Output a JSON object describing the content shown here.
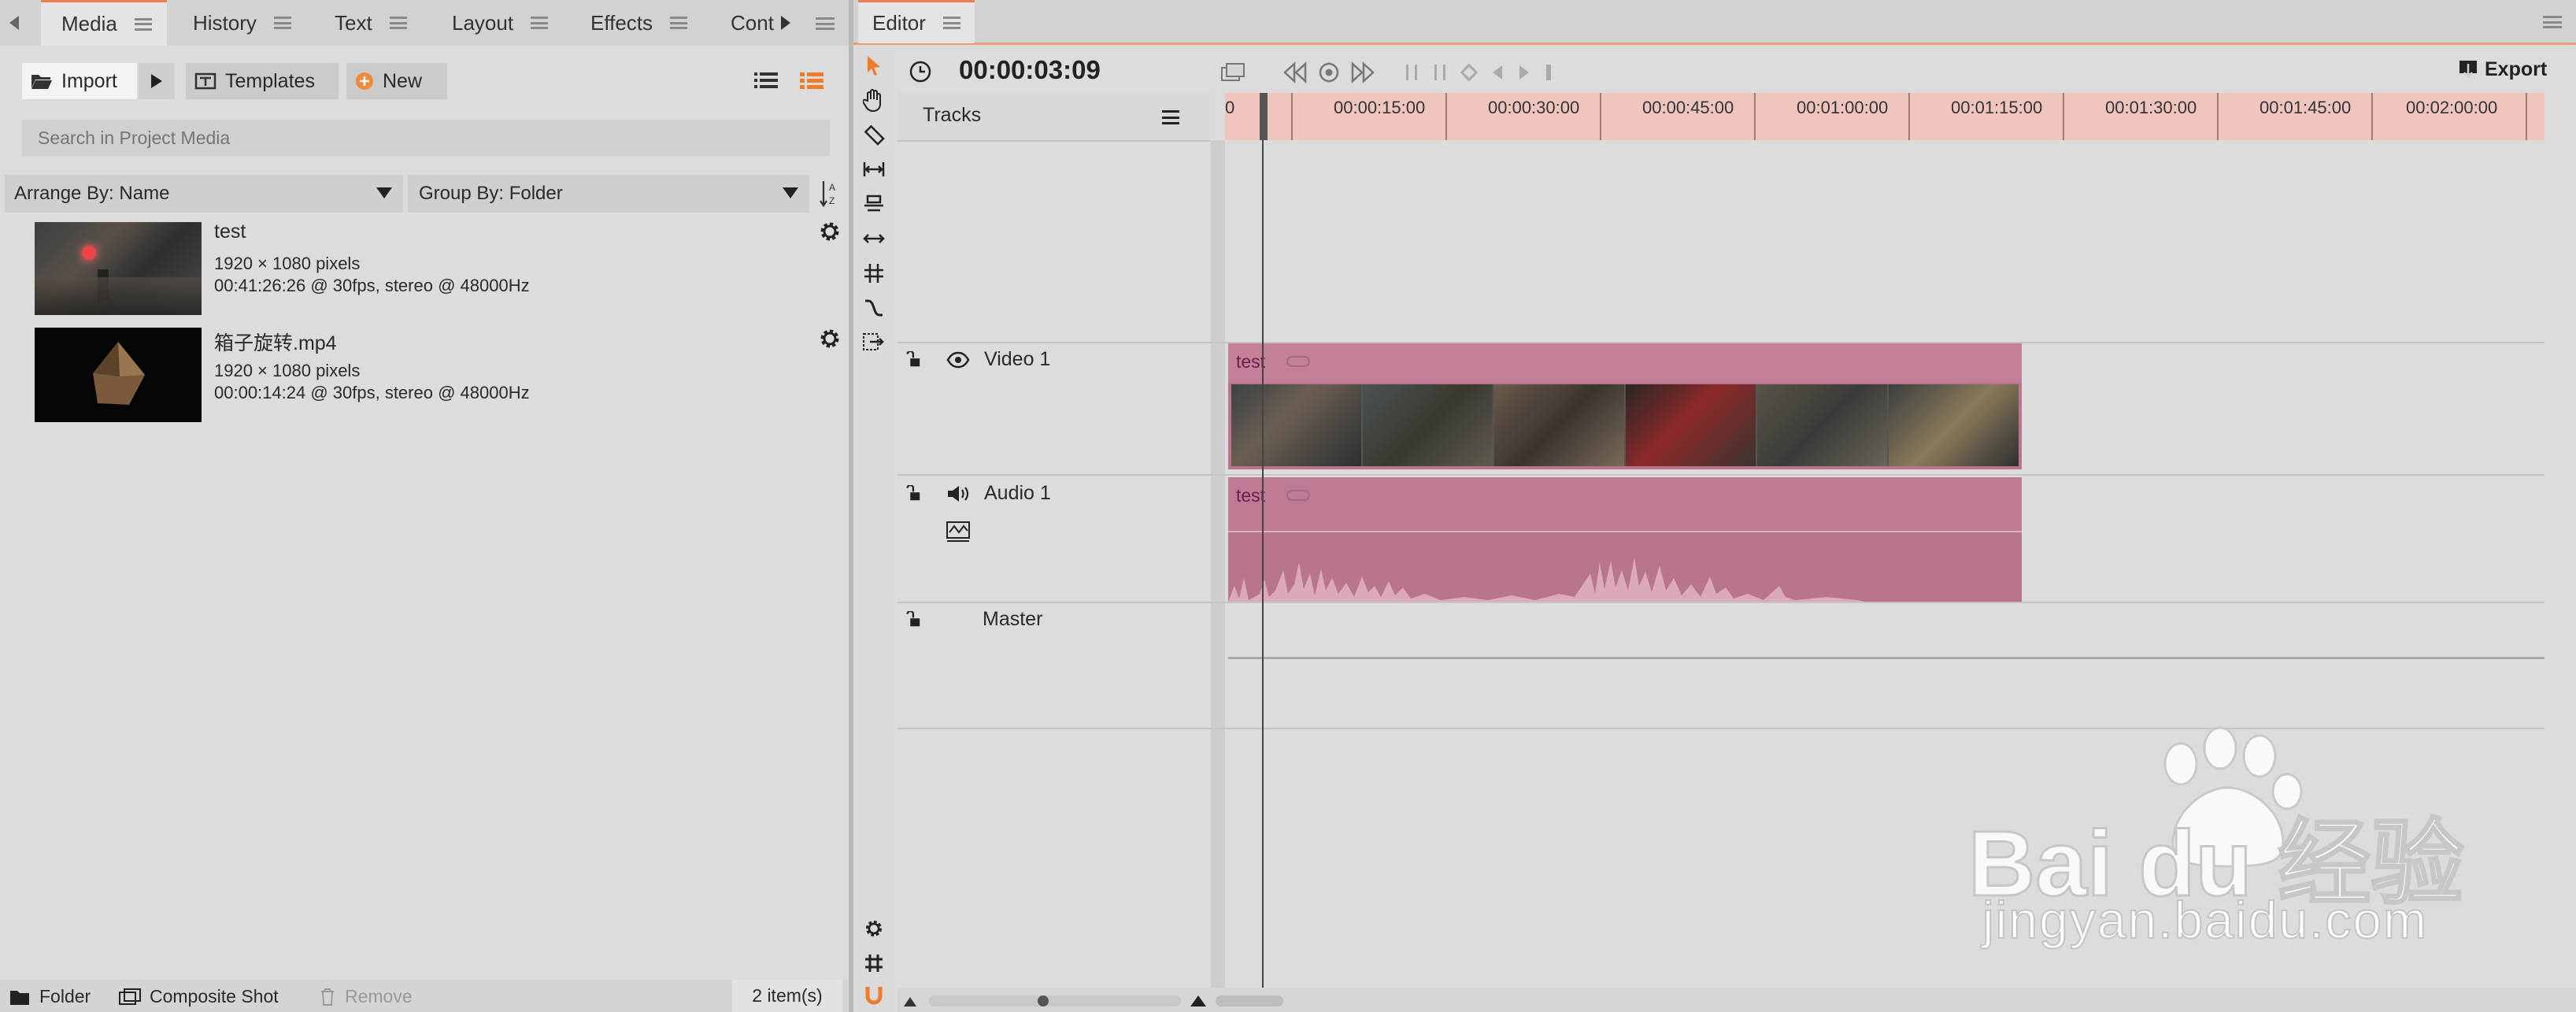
{
  "left_panel": {
    "tabs": [
      {
        "label": "Media",
        "active": true
      },
      {
        "label": "History",
        "active": false
      },
      {
        "label": "Text",
        "active": false
      },
      {
        "label": "Layout",
        "active": false
      },
      {
        "label": "Effects",
        "active": false
      },
      {
        "label": "Cont",
        "active": false
      }
    ],
    "toolbar": {
      "import_label": "Import",
      "templates_label": "Templates",
      "new_label": "New"
    },
    "search": {
      "placeholder": "Search in Project Media"
    },
    "arrange": {
      "label": "Arrange By: Name"
    },
    "group": {
      "label": "Group By: Folder"
    },
    "media_items": [
      {
        "name": "test",
        "resolution": "1920 × 1080 pixels",
        "details": "00:41:26:26 @ 30fps, stereo @ 48000Hz"
      },
      {
        "name": "箱子旋转.mp4",
        "resolution": "1920 × 1080 pixels",
        "details": "00:00:14:24 @ 30fps, stereo @ 48000Hz"
      }
    ],
    "footer": {
      "folder_label": "Folder",
      "composite_label": "Composite Shot",
      "remove_label": "Remove",
      "count": "2 item(s)"
    }
  },
  "editor": {
    "tab_label": "Editor",
    "timecode": "00:00:03:09",
    "export_label": "Export",
    "tracks_label": "Tracks",
    "ruler_labels": [
      "0",
      "00:00:15:00",
      "00:00:30:00",
      "00:00:45:00",
      "00:01:00:00",
      "00:01:15:00",
      "00:01:30:00",
      "00:01:45:00",
      "00:02:00:00"
    ],
    "tracks": [
      {
        "name": "Video 1",
        "clip_title": "test"
      },
      {
        "name": "Audio 1",
        "clip_title": "test"
      },
      {
        "name": "Master"
      }
    ]
  },
  "watermark": {
    "logo": "Bai du 经验",
    "url": "jingyan.baidu.com"
  },
  "colors": {
    "accent": "#f07b4f",
    "ruler": "#efc5bd",
    "clip": "#b97590",
    "clip_header": "#c48099"
  }
}
